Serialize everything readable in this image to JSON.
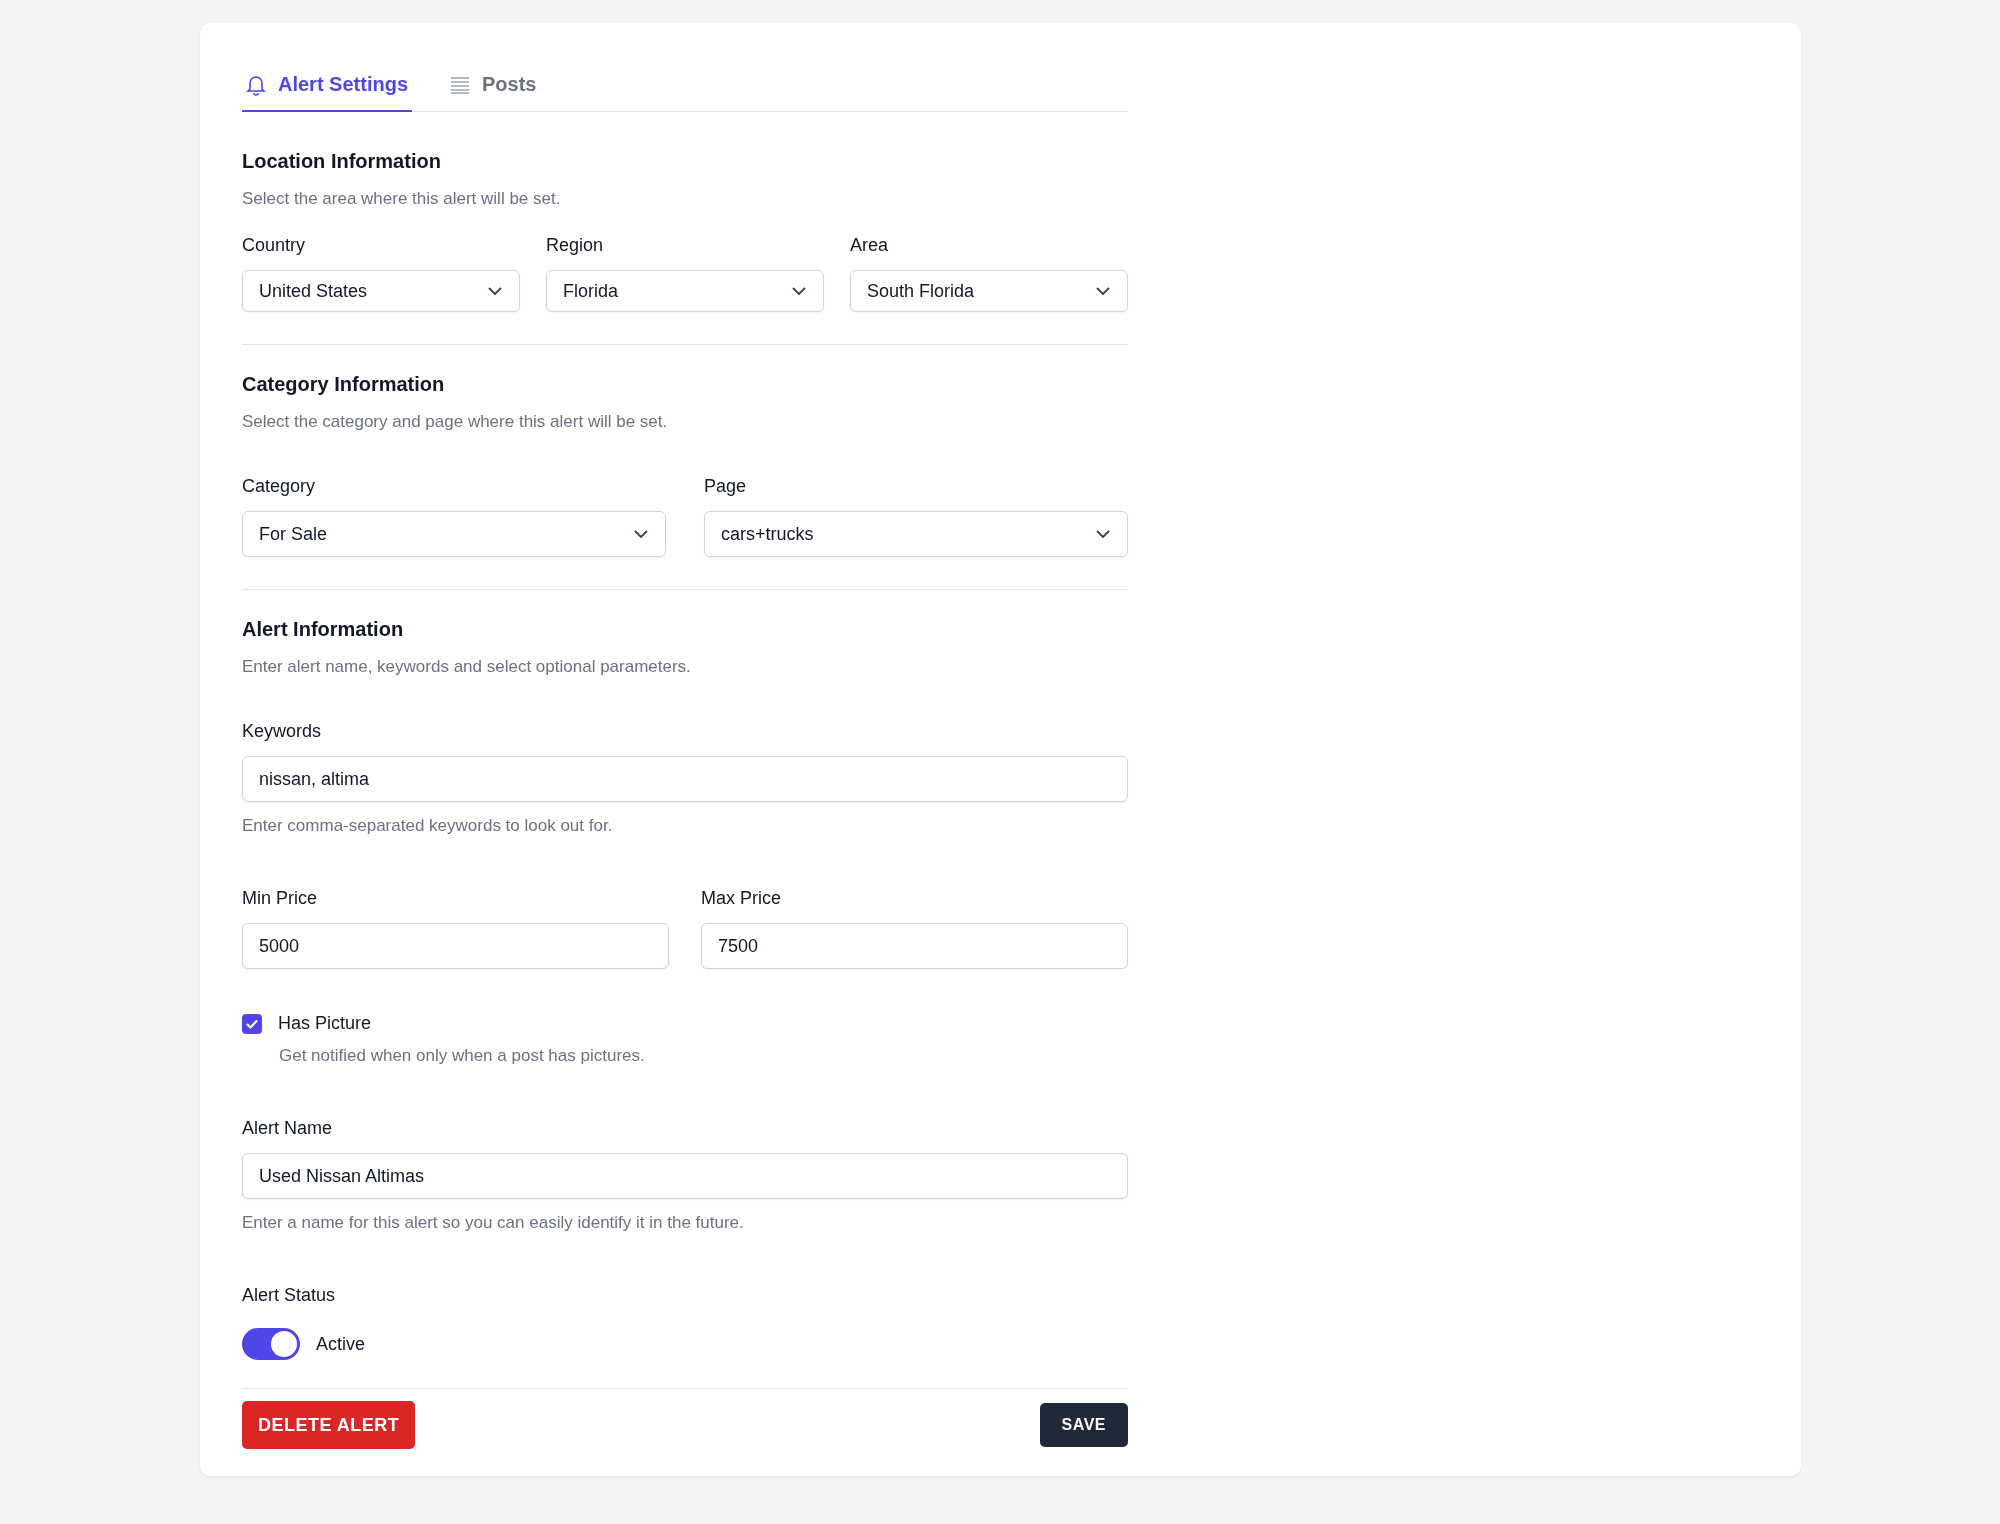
{
  "tabs": [
    {
      "label": "Alert Settings",
      "selected": true,
      "kind": "bell"
    },
    {
      "label": "Posts",
      "selected": false,
      "kind": "list"
    }
  ],
  "location": {
    "title": "Location Information",
    "description": "Select the area where this alert will be set.",
    "fields": [
      {
        "label": "Country",
        "value": "United States"
      },
      {
        "label": "Region",
        "value": "Florida"
      },
      {
        "label": "Area",
        "value": "South Florida"
      }
    ]
  },
  "category": {
    "title": "Category Information",
    "description": "Select the category and page where this alert will be set.",
    "fields": [
      {
        "label": "Category",
        "value": "For Sale"
      },
      {
        "label": "Page",
        "value": "cars+trucks"
      }
    ]
  },
  "alert": {
    "title": "Alert Information",
    "description": "Enter alert name, keywords and select optional parameters.",
    "keywords": {
      "label": "Keywords",
      "value": "nissan, altima",
      "help": "Enter comma-separated keywords to look out for."
    },
    "prices": [
      {
        "label": "Min Price",
        "value": "5000"
      },
      {
        "label": "Max Price",
        "value": "7500"
      }
    ],
    "has_picture": {
      "label": "Has Picture",
      "checked": true,
      "help": "Get notified when only when a post has pictures."
    },
    "alert_name": {
      "label": "Alert Name",
      "value": "Used Nissan Altimas",
      "help": "Enter a name for this alert so you can easily identify it in the future."
    },
    "alert_status": {
      "label": "Alert Status",
      "on": true,
      "text": "Active"
    }
  },
  "actions": {
    "delete": "DELETE ALERT",
    "save": "SAVE"
  }
}
